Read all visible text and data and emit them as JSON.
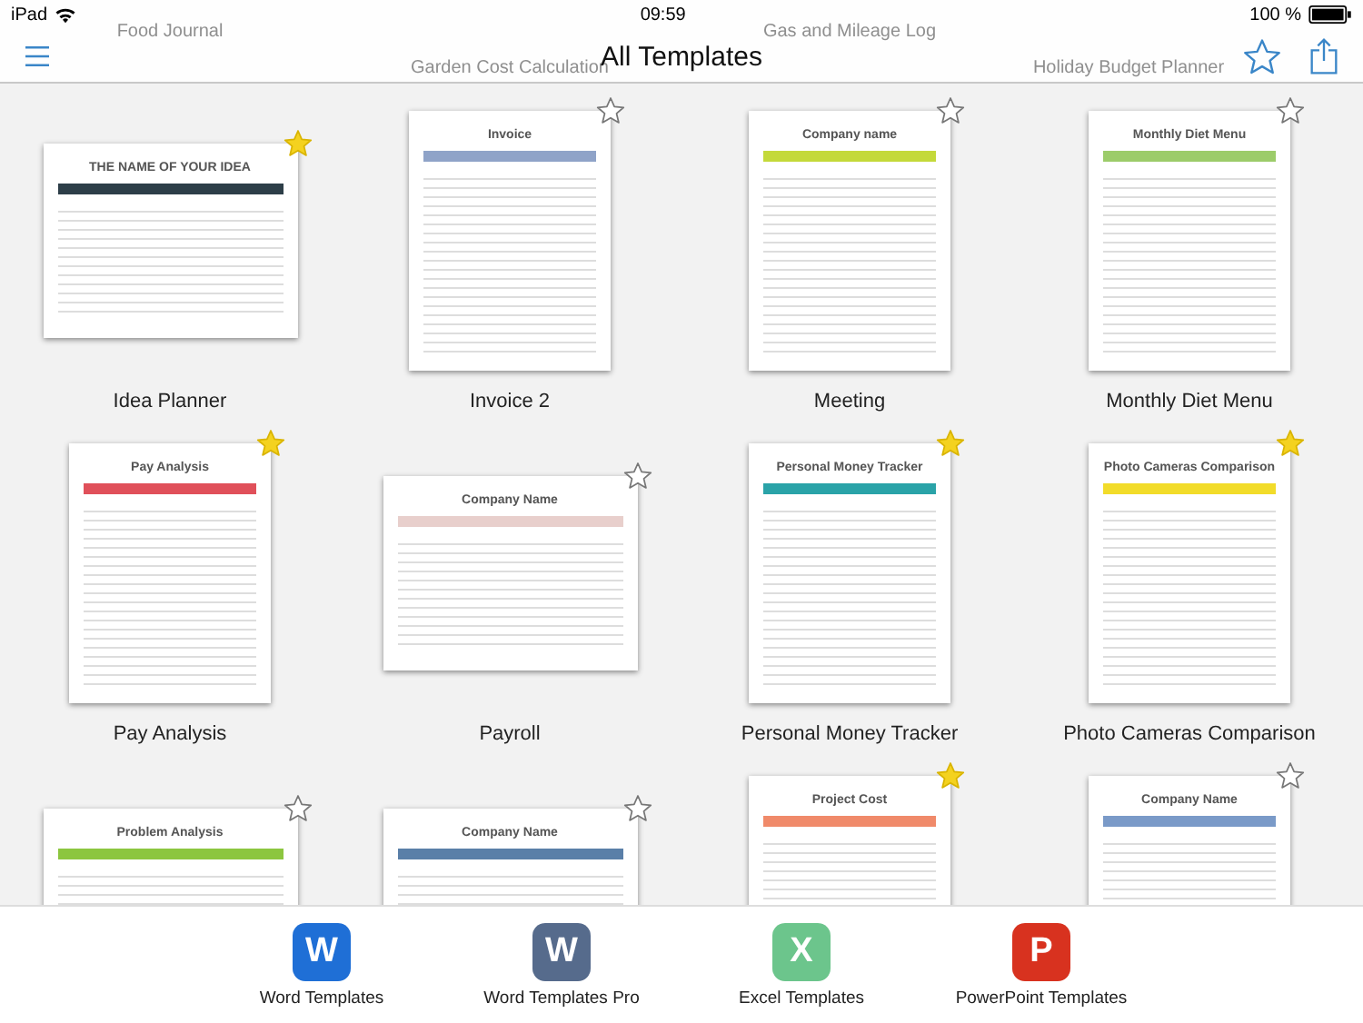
{
  "status_bar": {
    "device": "iPad",
    "time": "09:59",
    "battery": "100 %"
  },
  "nav_bar": {
    "title": "All Templates",
    "behind_titles": [
      "Food Journal",
      "Garden Cost Calculation",
      "Gas and Mileage Log",
      "Holiday Budget Planner"
    ]
  },
  "templates": [
    {
      "name": "Idea Planner",
      "kind": "landscape",
      "heading": "THE NAME OF YOUR IDEA",
      "color": "#2d3e48",
      "favorite": true
    },
    {
      "name": "Invoice 2",
      "kind": "portrait",
      "heading": "Invoice",
      "color": "#8fa3c8",
      "favorite": false
    },
    {
      "name": "Meeting",
      "kind": "portrait",
      "heading": "Company name",
      "color": "#c4d93a",
      "favorite": false
    },
    {
      "name": "Monthly Diet Menu",
      "kind": "portrait",
      "heading": "Monthly Diet Menu",
      "color": "#9ccc6a",
      "favorite": false
    },
    {
      "name": "Pay Analysis",
      "kind": "portrait",
      "heading": "Pay Analysis",
      "color": "#e0505a",
      "favorite": true
    },
    {
      "name": "Payroll",
      "kind": "landscape",
      "heading": "Company Name",
      "color": "#e8cfcc",
      "favorite": false
    },
    {
      "name": "Personal Money Tracker",
      "kind": "portrait",
      "heading": "Personal Money Tracker",
      "color": "#2aa3a8",
      "favorite": true
    },
    {
      "name": "Photo Cameras Comparison",
      "kind": "portrait",
      "heading": "Photo Cameras Comparison",
      "color": "#f2dc2a",
      "favorite": true
    },
    {
      "kind": "landscape",
      "heading": "Problem Analysis",
      "color": "#8cc63f",
      "favorite": false
    },
    {
      "kind": "landscape",
      "heading": "Company Name",
      "color": "#5a7fa8",
      "favorite": false
    },
    {
      "kind": "portrait",
      "heading": "Project Cost",
      "color": "#f08a6a",
      "favorite": true
    },
    {
      "kind": "portrait",
      "heading": "Company Name",
      "color": "#7a9ac8",
      "favorite": false
    }
  ],
  "tab_bar": [
    {
      "letter": "W",
      "label": "Word Templates",
      "color": "#1f6fd6"
    },
    {
      "letter": "W",
      "label": "Word Templates Pro",
      "color": "#566b8c"
    },
    {
      "letter": "X",
      "label": "Excel Templates",
      "color": "#6cc58c"
    },
    {
      "letter": "P",
      "label": "PowerPoint Templates",
      "color": "#d8321f"
    }
  ]
}
